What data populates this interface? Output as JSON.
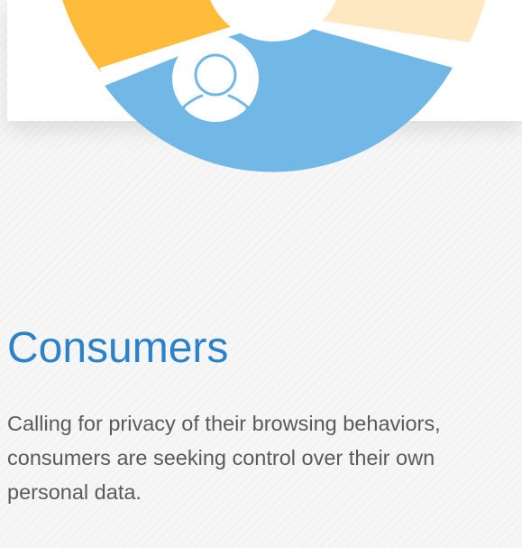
{
  "section": {
    "title": "Consumers",
    "description": "Calling for privacy of their browsing behaviors, consumers are seeking control over their own personal data."
  },
  "graphic": {
    "center_icon": "person-icon",
    "segments": [
      {
        "name": "left-segment",
        "color": "#FFBC3B"
      },
      {
        "name": "right-segment",
        "color": "#FDE8C2"
      },
      {
        "name": "bottom-segment",
        "color": "#72B8E6"
      }
    ],
    "divider_color": "#FFFFFF"
  }
}
